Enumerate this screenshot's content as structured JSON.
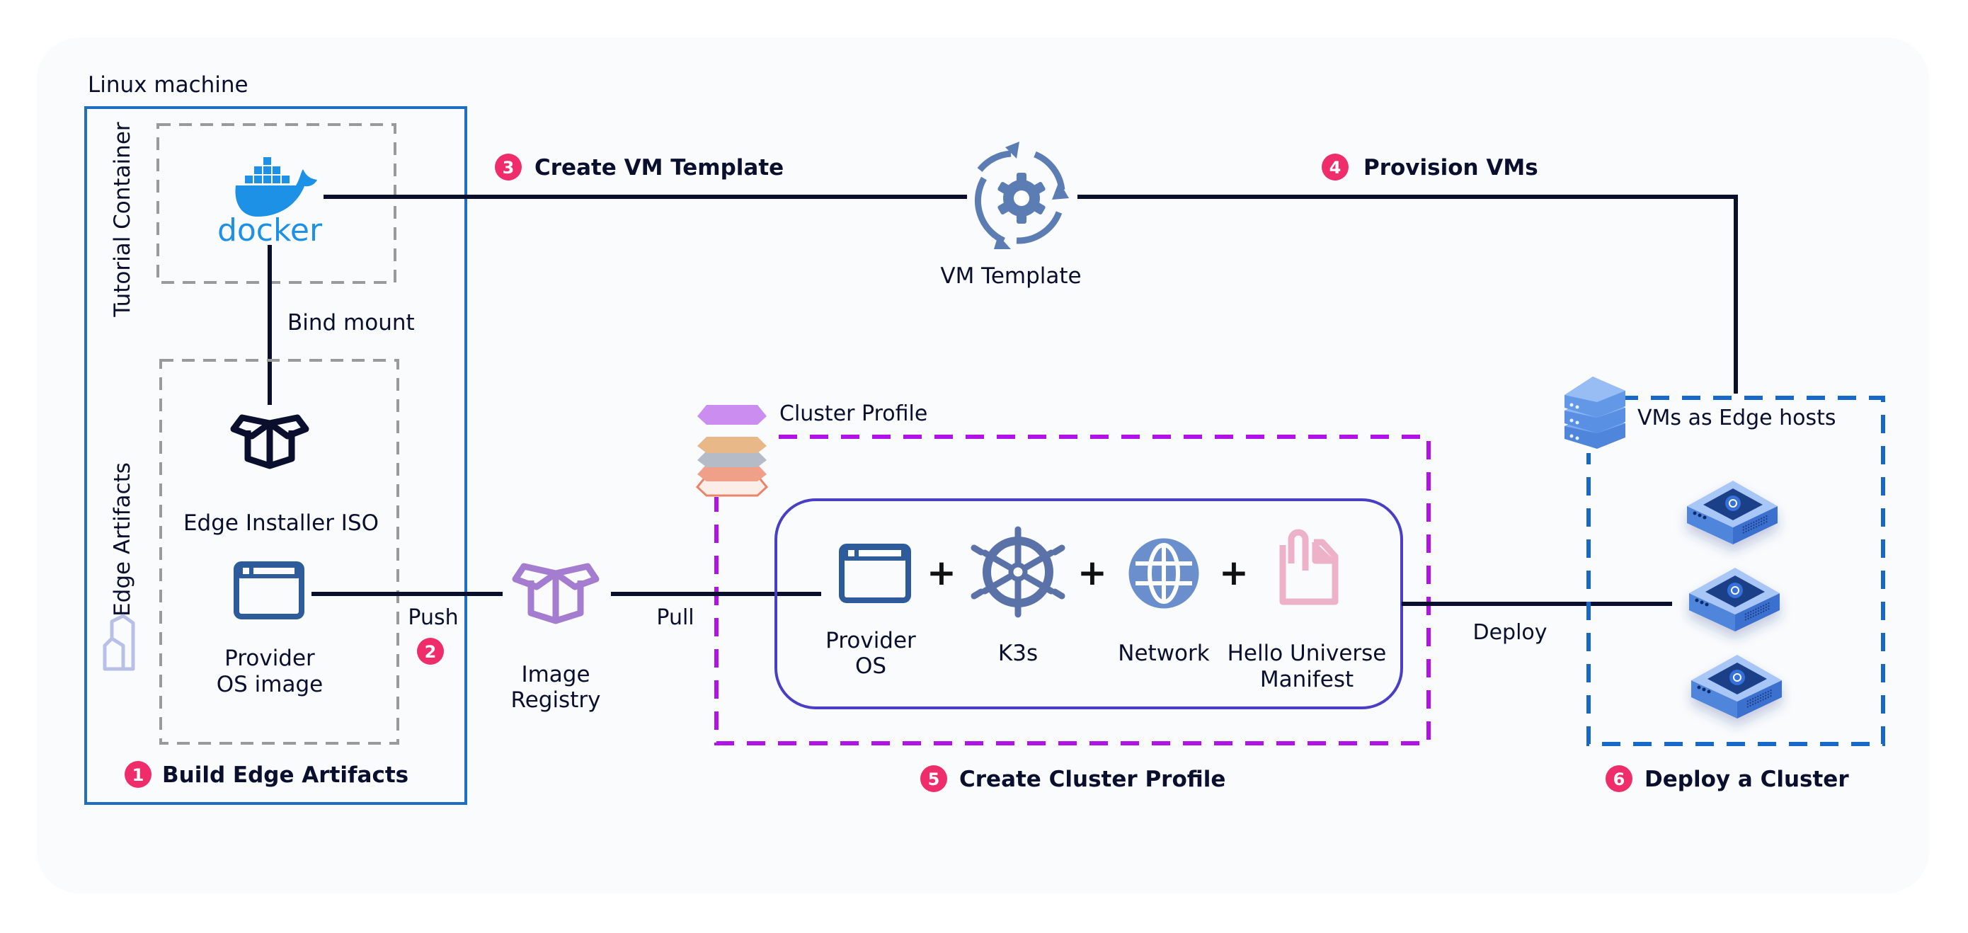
{
  "diagram": {
    "colors": {
      "panel_bg": "#fafbfd",
      "ink": "#0b0f2e",
      "linux_box": "#1e6fc4",
      "gray_dash": "#9a9a9a",
      "magenta_dash": "#b012e8",
      "cluster_box": "#4a3fc4",
      "edge_dash": "#1668c9",
      "badge": "#ef2d6a",
      "icon_blue": "#5b7db4",
      "docker_blue": "#1d91e6",
      "registry_purple": "#a57dd0",
      "manifest_pink": "#eeb2c8"
    },
    "linux_machine": {
      "label": "Linux machine",
      "tutorial_container_label": "Tutorial Container",
      "docker_label": "docker",
      "bind_mount_label": "Bind mount",
      "edge_artifacts_label": "Edge Artifacts",
      "edge_installer_iso_label": "Edge Installer ISO",
      "provider_os_image_label": [
        "Provider",
        "OS image"
      ]
    },
    "steps": [
      {
        "number": "1",
        "label": "Build Edge Artifacts"
      },
      {
        "number": "2",
        "label": "Push"
      },
      {
        "number": "3",
        "label": "Create VM Template"
      },
      {
        "number": "4",
        "label": "Provision VMs"
      },
      {
        "number": "5",
        "label": "Create Cluster Profile"
      },
      {
        "number": "6",
        "label": "Deploy a Cluster"
      }
    ],
    "vm_template_label": "VM Template",
    "image_registry_label": [
      "Image",
      "Registry"
    ],
    "pull_label": "Pull",
    "deploy_label": "Deploy",
    "cluster_profile": {
      "label": "Cluster Profile",
      "layers": [
        {
          "icon": "window-icon",
          "label": [
            "Provider",
            "OS"
          ]
        },
        {
          "icon": "kubernetes-helm-icon",
          "label": [
            "K3s"
          ]
        },
        {
          "icon": "globe-icon",
          "label": [
            "Network"
          ]
        },
        {
          "icon": "document-clip-icon",
          "label": [
            "Hello Universe",
            "Manifest"
          ]
        }
      ],
      "separator": "+"
    },
    "edge_hosts": {
      "label": "VMs as Edge hosts",
      "node_count": 3
    }
  }
}
